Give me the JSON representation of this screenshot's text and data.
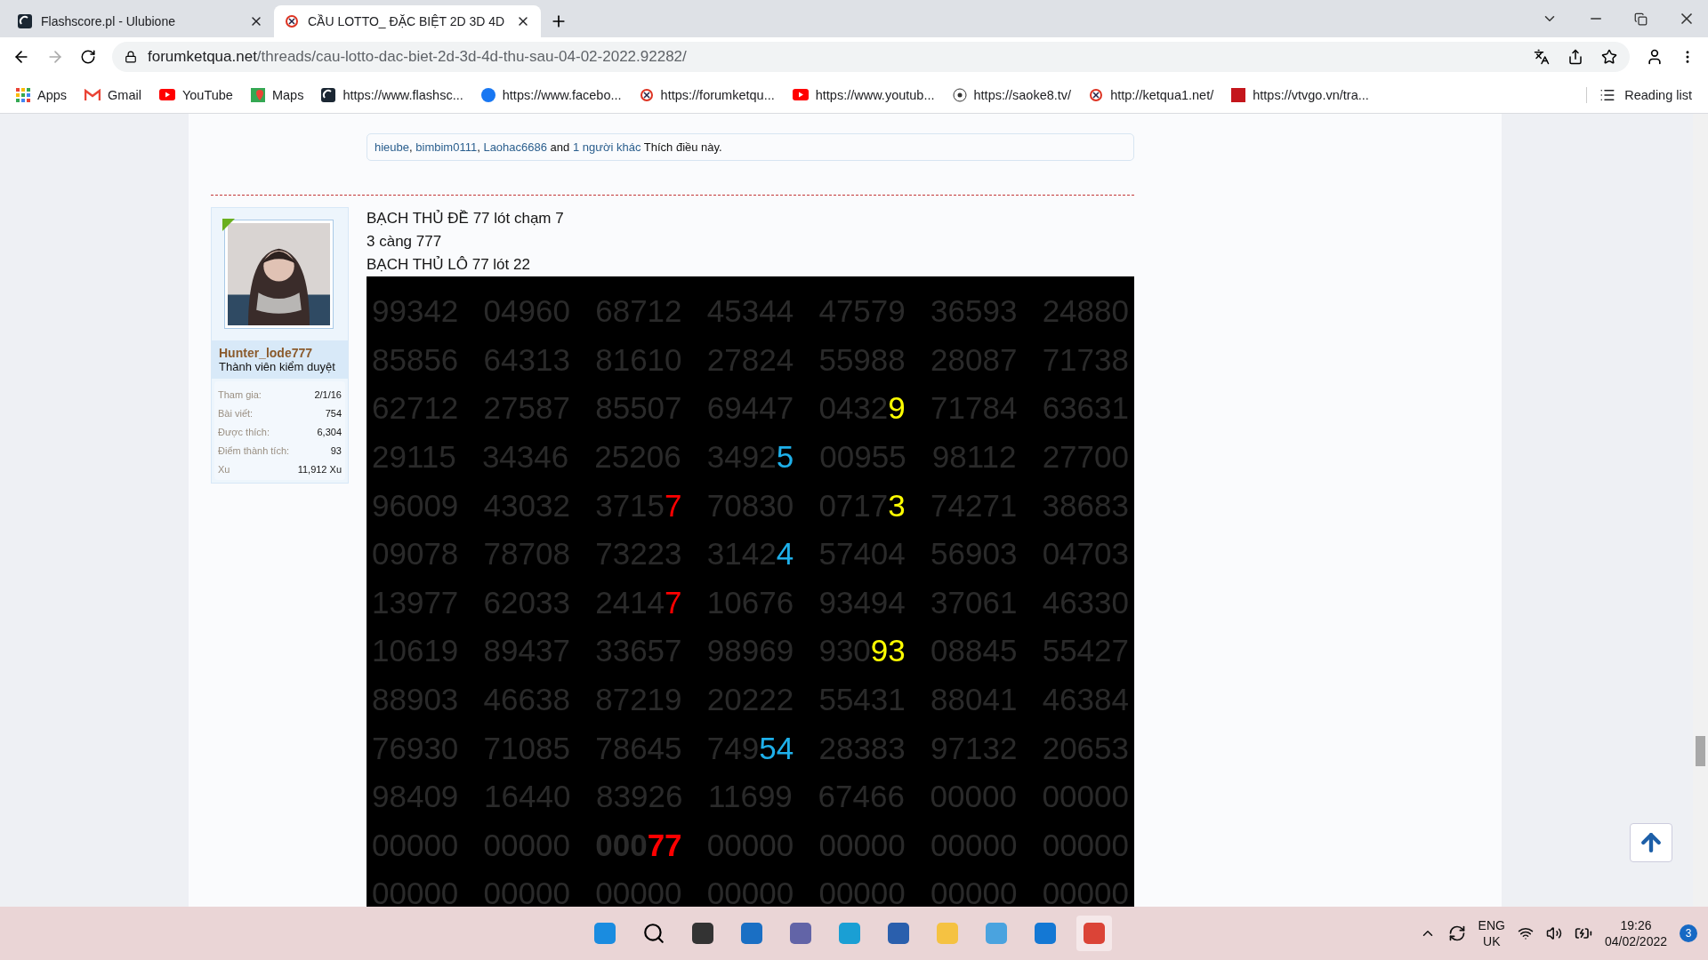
{
  "tabs": [
    {
      "title": "Flashscore.pl - Ulubione",
      "selected": false
    },
    {
      "title": "CẦU LOTTO_ ĐẶC BIỆT 2D 3D 4D",
      "selected": true
    }
  ],
  "address": {
    "domain": "forumketqua.net",
    "path": "/threads/cau-lotto-dac-biet-2d-3d-4d-thu-sau-04-02-2022.92282/"
  },
  "bookmarks": [
    "Apps",
    "Gmail",
    "YouTube",
    "Maps",
    "https://www.flashsc...",
    "https://www.facebo...",
    "https://forumketqu...",
    "https://www.youtub...",
    "https://saoke8.tv/",
    "http://ketqua1.net/",
    "https://vtvgo.vn/tra..."
  ],
  "reading_list": "Reading list",
  "likes": [
    {
      "text": "hieube",
      "kind": "link"
    },
    {
      "text": ", ",
      "kind": "plain"
    },
    {
      "text": "bimbim0111",
      "kind": "link"
    },
    {
      "text": ", ",
      "kind": "plain"
    },
    {
      "text": "Laohac6686",
      "kind": "link"
    },
    {
      "text": " and ",
      "kind": "plain"
    },
    {
      "text": "1 người khác",
      "kind": "link"
    },
    {
      "text": " Thích điều này.",
      "kind": "plain"
    }
  ],
  "user": {
    "name": "Hunter_lode777",
    "title": "Thành viên kiểm duyệt",
    "stats": [
      {
        "label": "Tham gia:",
        "value": "2/1/16"
      },
      {
        "label": "Bài viết:",
        "value": "754"
      },
      {
        "label": "Được thích:",
        "value": "6,304"
      },
      {
        "label": "Điểm thành tích:",
        "value": "93"
      },
      {
        "label": "Xu",
        "value": "11,912 Xu"
      }
    ]
  },
  "post_lines": [
    "BẠCH THỦ ĐỀ 77 lót chạm 7",
    "3 càng 777",
    "BẠCH THỦ LÔ 77 lót 22"
  ],
  "number_grid": [
    [
      {
        "text": "99342"
      },
      {
        "text": "04960"
      },
      {
        "text": "68712"
      },
      {
        "text": "45344"
      },
      {
        "text": "47579"
      },
      {
        "text": "36593"
      },
      {
        "text": "24880"
      }
    ],
    [
      {
        "text": "85856"
      },
      {
        "text": "64313"
      },
      {
        "text": "81610"
      },
      {
        "text": "27824"
      },
      {
        "text": "55988"
      },
      {
        "text": "28087"
      },
      {
        "text": "71738"
      }
    ],
    [
      {
        "text": "62712"
      },
      {
        "text": "27587"
      },
      {
        "text": "85507"
      },
      {
        "text": "69447"
      },
      {
        "text": "0432",
        "mark": "9",
        "color": "#ffff00"
      },
      {
        "text": "71784"
      },
      {
        "text": "63631"
      }
    ],
    [
      {
        "text": "29115"
      },
      {
        "text": "34346"
      },
      {
        "text": "25206"
      },
      {
        "text": "3492",
        "mark": "5",
        "color": "#1eb0ea"
      },
      {
        "text": "00955"
      },
      {
        "text": "98112"
      },
      {
        "text": "27700"
      }
    ],
    [
      {
        "text": "96009"
      },
      {
        "text": "43032"
      },
      {
        "text": "3715",
        "mark": "7",
        "color": "#ff0000"
      },
      {
        "text": "70830"
      },
      {
        "text": "0717",
        "mark": "3",
        "color": "#ffff00"
      },
      {
        "text": "74271"
      },
      {
        "text": "38683"
      }
    ],
    [
      {
        "text": "09078"
      },
      {
        "text": "78708"
      },
      {
        "text": "73223"
      },
      {
        "text": "3142",
        "mark": "4",
        "color": "#1eb0ea"
      },
      {
        "text": "57404"
      },
      {
        "text": "56903"
      },
      {
        "text": "04703"
      }
    ],
    [
      {
        "text": "13977"
      },
      {
        "text": "62033"
      },
      {
        "text": "2414",
        "mark": "7",
        "color": "#ff0000"
      },
      {
        "text": "10676"
      },
      {
        "text": "93494"
      },
      {
        "text": "37061"
      },
      {
        "text": "46330"
      }
    ],
    [
      {
        "text": "10619"
      },
      {
        "text": "89437"
      },
      {
        "text": "33657"
      },
      {
        "text": "98969"
      },
      {
        "text": "930",
        "mark": "93",
        "color": "#ffff00"
      },
      {
        "text": "08845"
      },
      {
        "text": "55427"
      }
    ],
    [
      {
        "text": "88903"
      },
      {
        "text": "46638"
      },
      {
        "text": "87219"
      },
      {
        "text": "20222"
      },
      {
        "text": "55431"
      },
      {
        "text": "88041"
      },
      {
        "text": "46384"
      }
    ],
    [
      {
        "text": "76930"
      },
      {
        "text": "71085"
      },
      {
        "text": "78645"
      },
      {
        "text": "749",
        "mark": "54",
        "color": "#1eb0ea"
      },
      {
        "text": "28383"
      },
      {
        "text": "97132"
      },
      {
        "text": "20653"
      }
    ],
    [
      {
        "text": "98409"
      },
      {
        "text": "16440"
      },
      {
        "text": "83926"
      },
      {
        "text": "11699"
      },
      {
        "text": "67466"
      },
      {
        "text": "00000"
      },
      {
        "text": "00000"
      }
    ],
    [
      {
        "text": "00000"
      },
      {
        "text": "00000"
      },
      {
        "text": "000",
        "mark": "77",
        "color": "#ff0000",
        "bold": true
      },
      {
        "text": "00000"
      },
      {
        "text": "00000"
      },
      {
        "text": "00000"
      },
      {
        "text": "00000"
      }
    ],
    [
      {
        "text": "00000"
      },
      {
        "text": "00000"
      },
      {
        "text": "00000"
      },
      {
        "text": "00000"
      },
      {
        "text": "00000"
      },
      {
        "text": "00000"
      },
      {
        "text": "00000"
      }
    ]
  ],
  "taskbar": {
    "lang": "ENG",
    "region": "UK",
    "time": "19:26",
    "date": "04/02/2022",
    "badge": "3"
  }
}
